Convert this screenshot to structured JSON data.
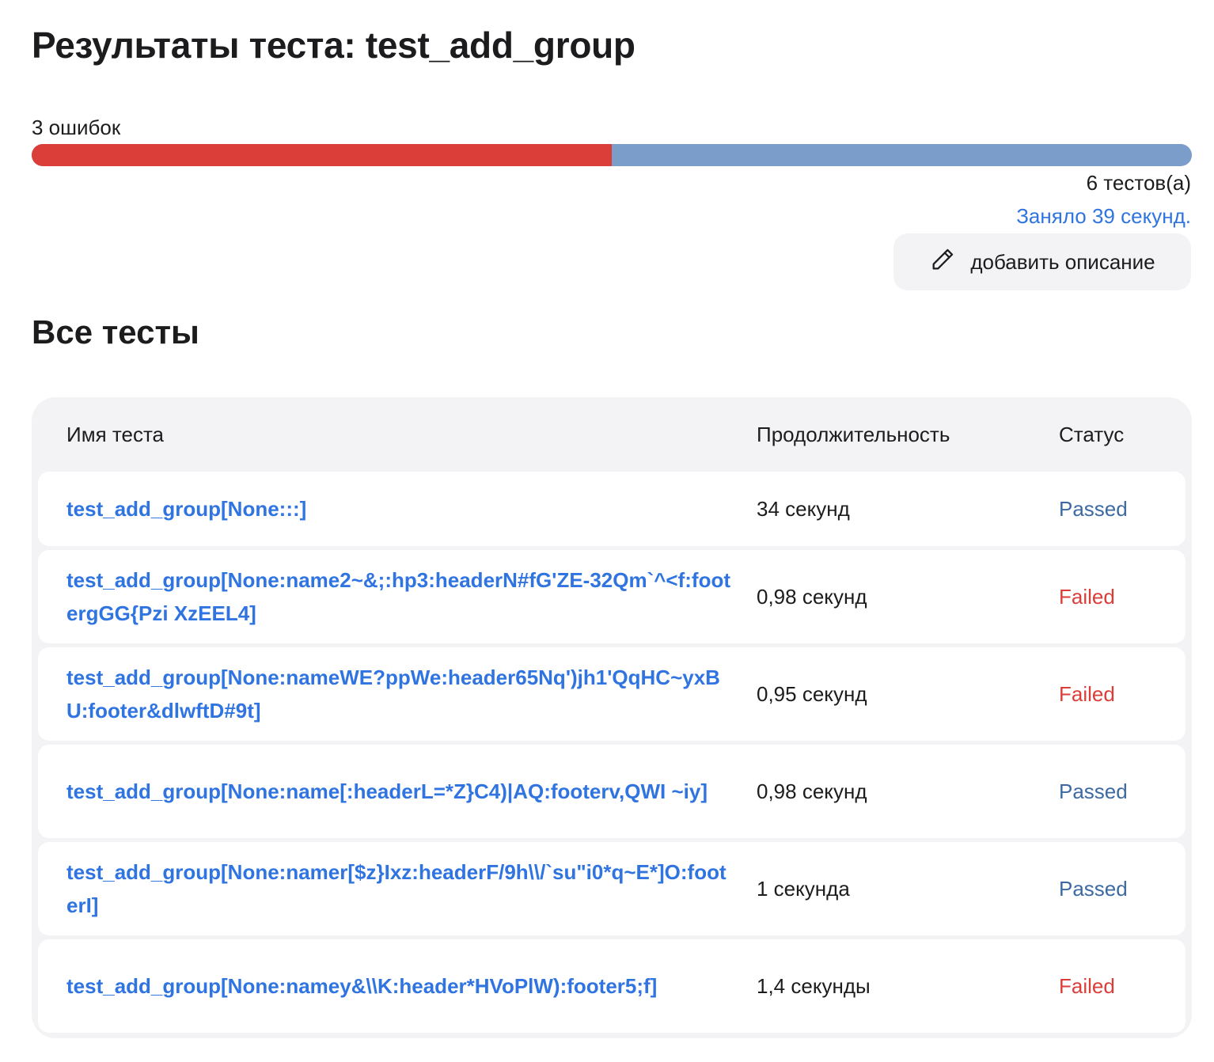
{
  "page": {
    "title": "Результаты теста: test_add_group"
  },
  "summary": {
    "errors_label": "3 ошибок",
    "failed": 3,
    "total": 6,
    "failed_fraction": 0.5,
    "tests_count_label": "6 тестов(а)",
    "duration_label": "Заняло 39 секунд.",
    "add_description_label": "добавить описание"
  },
  "section": {
    "title": "Все тесты"
  },
  "table": {
    "headers": {
      "name": "Имя теста",
      "duration": "Продолжительность",
      "status": "Статус"
    },
    "rows": [
      {
        "name": "test_add_group[None:::]",
        "duration": "34 секунд",
        "status": "Passed"
      },
      {
        "name": "test_add_group[None:name2~&;:hp3:headerN#fG'ZE-32Qm`^<f:footergGG{Pzi XzEEL4]",
        "duration": "0,98 секунд",
        "status": "Failed"
      },
      {
        "name": "test_add_group[None:nameWE?ppWe:header65Nq')jh1'QqHC~yxBU:footer&dlwftD#9t]",
        "duration": "0,95 секунд",
        "status": "Failed"
      },
      {
        "name": "test_add_group[None:name[:headerL=*Z}C4)|AQ:footerv,QWI ~iy]",
        "duration": "0,98 секунд",
        "status": "Passed"
      },
      {
        "name": "test_add_group[None:namer[$z}Ixz:headerF/9h\\\\/`su\"i0*q~E*]O:footerI]",
        "duration": "1 секунда",
        "status": "Passed"
      },
      {
        "name": "test_add_group[None:namey&\\\\K:header*HVoPlW):footer5;f]",
        "duration": "1,4 секунды",
        "status": "Failed"
      }
    ]
  },
  "colors": {
    "failed": "#db3e38",
    "passed_bar": "#7b9dc9",
    "link": "#2f74e0",
    "passed_text": "#3d69a3"
  },
  "icons": {
    "edit": "pencil-icon"
  }
}
